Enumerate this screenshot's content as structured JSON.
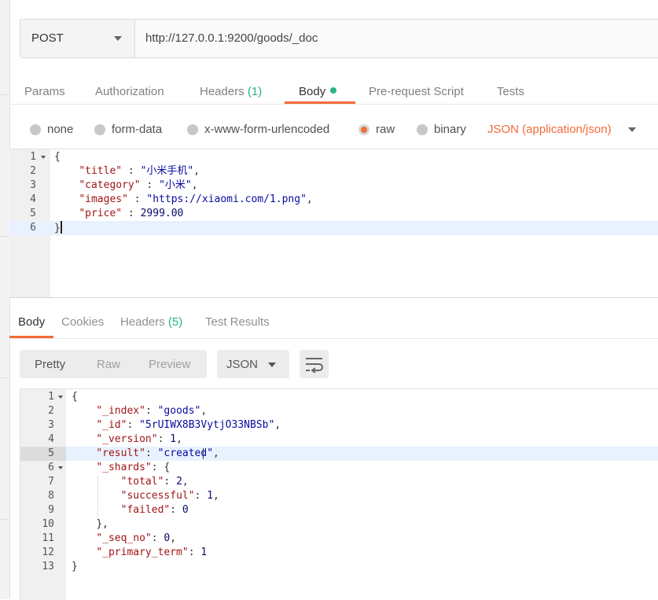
{
  "request": {
    "method": "POST",
    "url": "http://127.0.0.1:9200/goods/_doc",
    "tabs": [
      {
        "label": "Params",
        "count": ""
      },
      {
        "label": "Authorization",
        "count": ""
      },
      {
        "label": "Headers",
        "count": "(1)"
      },
      {
        "label": "Body",
        "count": ""
      },
      {
        "label": "Pre-request Script",
        "count": ""
      },
      {
        "label": "Tests",
        "count": ""
      }
    ],
    "active_tab": "Body",
    "body_types": [
      "none",
      "form-data",
      "x-www-form-urlencoded",
      "raw",
      "binary"
    ],
    "selected_body_type": "raw",
    "content_type": "JSON (application/json)",
    "line_numbers": [
      "1",
      "2",
      "3",
      "4",
      "5",
      "6"
    ],
    "body_lines": [
      {
        "key": "",
        "value": "",
        "open": "{"
      },
      {
        "key": "\"title\"",
        "sep": " : ",
        "value": "\"小米手机\"",
        "end": ","
      },
      {
        "key": "\"category\"",
        "sep": " : ",
        "value": "\"小米\"",
        "end": ","
      },
      {
        "key": "\"images\"",
        "sep": " : ",
        "value": "\"https://xiaomi.com/1.png\"",
        "end": ","
      },
      {
        "key": "\"price\"",
        "sep": " : ",
        "value": "2999.00",
        "end": ""
      },
      {
        "key": "",
        "value": "",
        "open": "}"
      }
    ]
  },
  "response": {
    "tabs": [
      {
        "label": "Body",
        "count": ""
      },
      {
        "label": "Cookies",
        "count": ""
      },
      {
        "label": "Headers",
        "count": "(5)"
      },
      {
        "label": "Test Results",
        "count": ""
      }
    ],
    "active_tab": "Body",
    "view_modes": [
      "Pretty",
      "Raw",
      "Preview"
    ],
    "active_view": "Pretty",
    "format": "JSON",
    "line_numbers": [
      "1",
      "2",
      "3",
      "4",
      "5",
      "6",
      "7",
      "8",
      "9",
      "10",
      "11",
      "12",
      "13"
    ],
    "lines": [
      {
        "text": "{"
      },
      {
        "key": "\"_index\"",
        "sep": ": ",
        "value": "\"goods\"",
        "vtype": "s",
        "end": ","
      },
      {
        "key": "\"_id\"",
        "sep": ": ",
        "value": "\"5rUIWX8B3VytjO33NBSb\"",
        "vtype": "s",
        "end": ","
      },
      {
        "key": "\"_version\"",
        "sep": ": ",
        "value": "1",
        "vtype": "n",
        "end": ","
      },
      {
        "key": "\"result\"",
        "sep": ": ",
        "value": "\"created\"",
        "vtype": "s",
        "end": ","
      },
      {
        "key": "\"_shards\"",
        "sep": ": ",
        "value": "{",
        "vtype": "p",
        "end": ""
      },
      {
        "key": "\"total\"",
        "sep": ": ",
        "value": "2",
        "vtype": "n",
        "end": ","
      },
      {
        "key": "\"successful\"",
        "sep": ": ",
        "value": "1",
        "vtype": "n",
        "end": ","
      },
      {
        "key": "\"failed\"",
        "sep": ": ",
        "value": "0",
        "vtype": "n",
        "end": ""
      },
      {
        "text": "},"
      },
      {
        "key": "\"_seq_no\"",
        "sep": ": ",
        "value": "0",
        "vtype": "n",
        "end": ","
      },
      {
        "key": "\"_primary_term\"",
        "sep": ": ",
        "value": "1",
        "vtype": "n",
        "end": ""
      },
      {
        "text": "}"
      }
    ]
  },
  "icons": {
    "method_dropdown": "chevron-down-icon",
    "content_type_dropdown": "chevron-down-icon",
    "format_dropdown": "chevron-down-icon",
    "wrap": "wrap-lines-icon",
    "fold": "fold-arrow-icon"
  },
  "colors": {
    "accent": "#f26b3a",
    "count": "#26b47f",
    "json_key": "#a11515",
    "json_string": "#0a0aa0"
  }
}
